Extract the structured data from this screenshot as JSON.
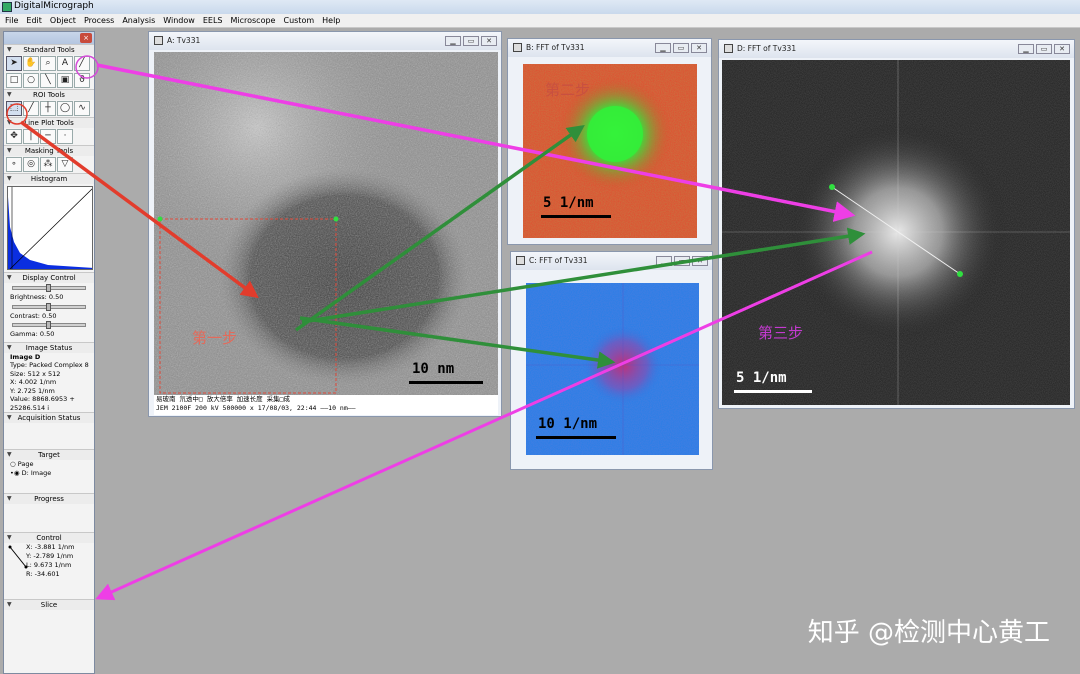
{
  "app": {
    "title": "DigitalMicrograph"
  },
  "menu": [
    "File",
    "Edit",
    "Object",
    "Process",
    "Analysis",
    "Window",
    "EELS",
    "Microscope",
    "Custom",
    "Help"
  ],
  "palette": {
    "close_glyph": "×",
    "sections": {
      "standard_tools": "Standard Tools",
      "roi_tools": "ROI Tools",
      "line_plot_tools": "Line Plot Tools",
      "masking_tools": "Masking Tools",
      "histogram": "Histogram",
      "display_control": "Display Control",
      "image_status": "Image Status",
      "acquisition_status": "Acquisition Status",
      "target": "Target",
      "progress": "Progress",
      "control": "Control",
      "slice": "Slice"
    },
    "display_control": {
      "brightness": "Brightness: 0.50",
      "contrast": "Contrast: 0.50",
      "gamma": "Gamma: 0.50",
      "brightness_level": 0.5,
      "contrast_level": 0.5,
      "gamma_level": 0.5
    },
    "image_status": {
      "name": "Image D",
      "type": "Type:  Packed Complex 8",
      "size": "Size:  512 x 512",
      "x": "X:     4.002 1/nm",
      "y": "Y:     2.725 1/nm",
      "value1": "Value: 8868.6953 +",
      "value2": "        25286.514 i"
    },
    "target": {
      "page": "Page",
      "image": "D: Image"
    },
    "control": {
      "x": "X: -3.881 1/nm",
      "y": "Y: -2.789 1/nm",
      "l": "L: 9.673 1/nm",
      "r": "R: -34.601"
    }
  },
  "windows": {
    "a": {
      "title": "A: Tv331",
      "scale": "10  nm",
      "annot_line1": "易玻南   氘透中□  放大倍率  加速长度      采集□成",
      "annot_line2": "JEM 2100F  200 kV  500000 x      17/08/03, 22:44  ——10 nm——",
      "step1": "第一步"
    },
    "b": {
      "title": "B: FFT of Tv331",
      "scale": "5 1/nm",
      "step2": "第二步"
    },
    "c": {
      "title": "C: FFT of Tv331",
      "scale": "10 1/nm"
    },
    "d": {
      "title": "D: FFT of Tv331",
      "scale": "5 1/nm",
      "step3": "第三步"
    }
  },
  "window_controls": {
    "minimize": "▁",
    "maximize": "▭",
    "close": "✕"
  },
  "colors": {
    "fft_b_bg": "#e8402a",
    "fft_b_spot": "#27e83a",
    "fft_c_bg": "#1f7ee8",
    "fft_c_spot": "#c0307a",
    "fft_d_bg": "#1a1a1a",
    "annot_red": "#e23c2c",
    "arrow_magenta": "#ee3ee6",
    "arrow_green": "#2f8f3a"
  },
  "watermark": "知乎 @检测中心黄工"
}
